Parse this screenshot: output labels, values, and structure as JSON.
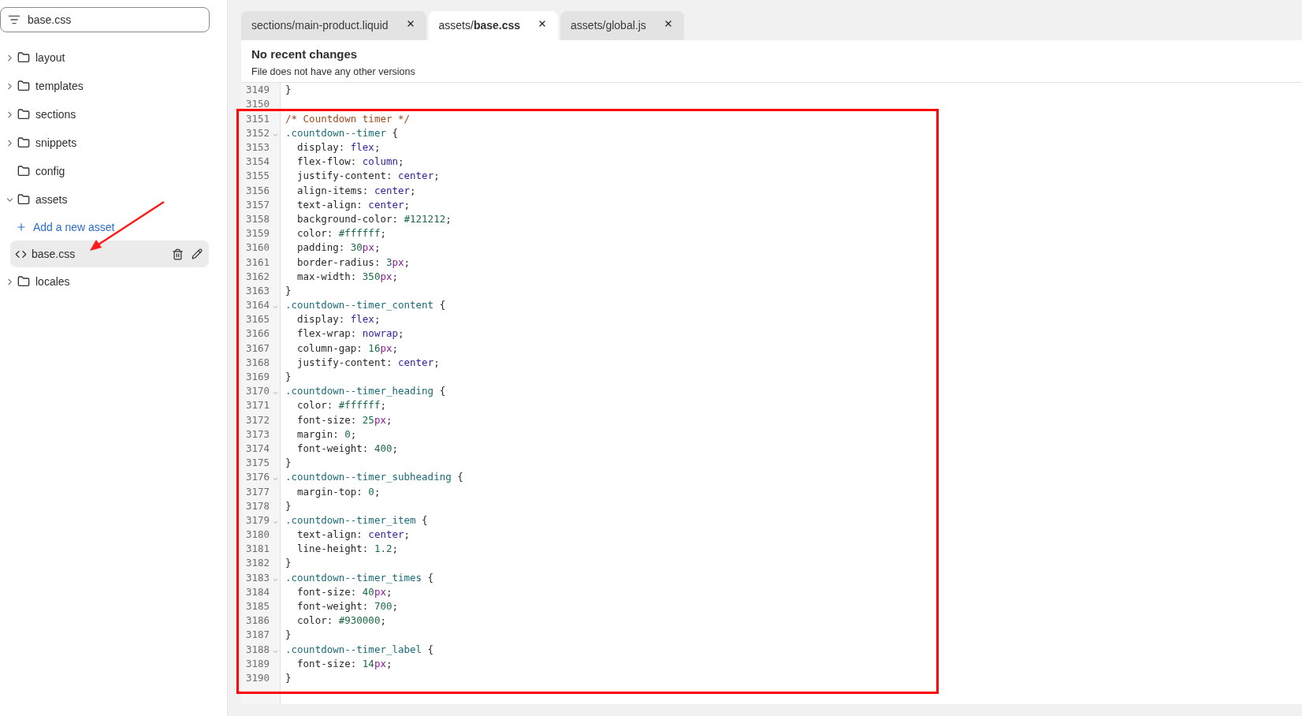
{
  "sidebar": {
    "search": {
      "value": "base.css"
    },
    "tree": [
      {
        "label": "layout",
        "expanded": false
      },
      {
        "label": "templates",
        "expanded": false
      },
      {
        "label": "sections",
        "expanded": false
      },
      {
        "label": "snippets",
        "expanded": false
      },
      {
        "label": "config"
      },
      {
        "label": "assets",
        "expanded": true,
        "children": [
          {
            "kind": "action",
            "label": "Add a new asset"
          },
          {
            "kind": "file",
            "label": "base.css",
            "selected": true
          }
        ]
      },
      {
        "label": "locales",
        "expanded": false
      }
    ]
  },
  "tabs": [
    {
      "label": "sections/main-product.liquid",
      "selected": false
    },
    {
      "label": "assets/**base.css**",
      "selected": true
    },
    {
      "label": "assets/global.js",
      "selected": false
    }
  ],
  "history": {
    "title": "No recent changes",
    "subtitle": "File does not have any other versions"
  },
  "editor": {
    "lines": [
      {
        "number": "3149",
        "tokens": [
          {
            "kind": "plain",
            "text": "}"
          }
        ]
      },
      {
        "number": "3150"
      },
      {
        "number": "3151",
        "tokens": [
          {
            "kind": "comment",
            "text": "/* Countdown timer */"
          }
        ]
      },
      {
        "number": "3152",
        "foldable": true,
        "tokens": [
          {
            "kind": "selector",
            "text": ".countdown--timer"
          },
          {
            "kind": "plain",
            "text": " {"
          }
        ]
      },
      {
        "number": "3153",
        "tokens": [
          {
            "kind": "plain",
            "text": "  display: "
          },
          {
            "kind": "keyword",
            "text": "flex"
          },
          {
            "kind": "plain",
            "text": ";"
          }
        ]
      },
      {
        "number": "3154",
        "tokens": [
          {
            "kind": "plain",
            "text": "  flex-flow: "
          },
          {
            "kind": "keyword",
            "text": "column"
          },
          {
            "kind": "plain",
            "text": ";"
          }
        ]
      },
      {
        "number": "3155",
        "tokens": [
          {
            "kind": "plain",
            "text": "  justify-content: "
          },
          {
            "kind": "keyword",
            "text": "center"
          },
          {
            "kind": "plain",
            "text": ";"
          }
        ]
      },
      {
        "number": "3156",
        "tokens": [
          {
            "kind": "plain",
            "text": "  align-items: "
          },
          {
            "kind": "keyword",
            "text": "center"
          },
          {
            "kind": "plain",
            "text": ";"
          }
        ]
      },
      {
        "number": "3157",
        "tokens": [
          {
            "kind": "plain",
            "text": "  text-align: "
          },
          {
            "kind": "keyword",
            "text": "center"
          },
          {
            "kind": "plain",
            "text": ";"
          }
        ]
      },
      {
        "number": "3158",
        "tokens": [
          {
            "kind": "plain",
            "text": "  background-color: "
          },
          {
            "kind": "number",
            "text": "#121212"
          },
          {
            "kind": "plain",
            "text": ";"
          }
        ]
      },
      {
        "number": "3159",
        "tokens": [
          {
            "kind": "plain",
            "text": "  color: "
          },
          {
            "kind": "number",
            "text": "#ffffff"
          },
          {
            "kind": "plain",
            "text": ";"
          }
        ]
      },
      {
        "number": "3160",
        "tokens": [
          {
            "kind": "plain",
            "text": "  padding: "
          },
          {
            "kind": "number",
            "text": "30"
          },
          {
            "kind": "unit",
            "text": "px"
          },
          {
            "kind": "plain",
            "text": ";"
          }
        ]
      },
      {
        "number": "3161",
        "tokens": [
          {
            "kind": "plain",
            "text": "  border-radius: "
          },
          {
            "kind": "number",
            "text": "3"
          },
          {
            "kind": "unit",
            "text": "px"
          },
          {
            "kind": "plain",
            "text": ";"
          }
        ]
      },
      {
        "number": "3162",
        "tokens": [
          {
            "kind": "plain",
            "text": "  max-width: "
          },
          {
            "kind": "number",
            "text": "350"
          },
          {
            "kind": "unit",
            "text": "px"
          },
          {
            "kind": "plain",
            "text": ";"
          }
        ]
      },
      {
        "number": "3163",
        "tokens": [
          {
            "kind": "plain",
            "text": "}"
          }
        ]
      },
      {
        "number": "3164",
        "foldable": true,
        "tokens": [
          {
            "kind": "selector",
            "text": ".countdown--timer_content"
          },
          {
            "kind": "plain",
            "text": " {"
          }
        ]
      },
      {
        "number": "3165",
        "tokens": [
          {
            "kind": "plain",
            "text": "  display: "
          },
          {
            "kind": "keyword",
            "text": "flex"
          },
          {
            "kind": "plain",
            "text": ";"
          }
        ]
      },
      {
        "number": "3166",
        "tokens": [
          {
            "kind": "plain",
            "text": "  flex-wrap: "
          },
          {
            "kind": "keyword",
            "text": "nowrap"
          },
          {
            "kind": "plain",
            "text": ";"
          }
        ]
      },
      {
        "number": "3167",
        "tokens": [
          {
            "kind": "plain",
            "text": "  column-gap: "
          },
          {
            "kind": "number",
            "text": "16"
          },
          {
            "kind": "unit",
            "text": "px"
          },
          {
            "kind": "plain",
            "text": ";"
          }
        ]
      },
      {
        "number": "3168",
        "tokens": [
          {
            "kind": "plain",
            "text": "  justify-content: "
          },
          {
            "kind": "keyword",
            "text": "center"
          },
          {
            "kind": "plain",
            "text": ";"
          }
        ]
      },
      {
        "number": "3169",
        "tokens": [
          {
            "kind": "plain",
            "text": "}"
          }
        ]
      },
      {
        "number": "3170",
        "foldable": true,
        "tokens": [
          {
            "kind": "selector",
            "text": ".countdown--timer_heading"
          },
          {
            "kind": "plain",
            "text": " {"
          }
        ]
      },
      {
        "number": "3171",
        "tokens": [
          {
            "kind": "plain",
            "text": "  color: "
          },
          {
            "kind": "number",
            "text": "#ffffff"
          },
          {
            "kind": "plain",
            "text": ";"
          }
        ]
      },
      {
        "number": "3172",
        "tokens": [
          {
            "kind": "plain",
            "text": "  font-size: "
          },
          {
            "kind": "number",
            "text": "25"
          },
          {
            "kind": "unit",
            "text": "px"
          },
          {
            "kind": "plain",
            "text": ";"
          }
        ]
      },
      {
        "number": "3173",
        "tokens": [
          {
            "kind": "plain",
            "text": "  margin: "
          },
          {
            "kind": "number",
            "text": "0"
          },
          {
            "kind": "plain",
            "text": ";"
          }
        ]
      },
      {
        "number": "3174",
        "tokens": [
          {
            "kind": "plain",
            "text": "  font-weight: "
          },
          {
            "kind": "number",
            "text": "400"
          },
          {
            "kind": "plain",
            "text": ";"
          }
        ]
      },
      {
        "number": "3175",
        "tokens": [
          {
            "kind": "plain",
            "text": "}"
          }
        ]
      },
      {
        "number": "3176",
        "foldable": true,
        "tokens": [
          {
            "kind": "selector",
            "text": ".countdown--timer_subheading"
          },
          {
            "kind": "plain",
            "text": " {"
          }
        ]
      },
      {
        "number": "3177",
        "tokens": [
          {
            "kind": "plain",
            "text": "  margin-top: "
          },
          {
            "kind": "number",
            "text": "0"
          },
          {
            "kind": "plain",
            "text": ";"
          }
        ]
      },
      {
        "number": "3178",
        "tokens": [
          {
            "kind": "plain",
            "text": "}"
          }
        ]
      },
      {
        "number": "3179",
        "foldable": true,
        "tokens": [
          {
            "kind": "selector",
            "text": ".countdown--timer_item"
          },
          {
            "kind": "plain",
            "text": " {"
          }
        ]
      },
      {
        "number": "3180",
        "tokens": [
          {
            "kind": "plain",
            "text": "  text-align: "
          },
          {
            "kind": "keyword",
            "text": "center"
          },
          {
            "kind": "plain",
            "text": ";"
          }
        ]
      },
      {
        "number": "3181",
        "tokens": [
          {
            "kind": "plain",
            "text": "  line-height: "
          },
          {
            "kind": "number",
            "text": "1.2"
          },
          {
            "kind": "plain",
            "text": ";"
          }
        ]
      },
      {
        "number": "3182",
        "tokens": [
          {
            "kind": "plain",
            "text": "}"
          }
        ]
      },
      {
        "number": "3183",
        "foldable": true,
        "tokens": [
          {
            "kind": "selector",
            "text": ".countdown--timer_times"
          },
          {
            "kind": "plain",
            "text": " {"
          }
        ]
      },
      {
        "number": "3184",
        "tokens": [
          {
            "kind": "plain",
            "text": "  font-size: "
          },
          {
            "kind": "number",
            "text": "40"
          },
          {
            "kind": "unit",
            "text": "px"
          },
          {
            "kind": "plain",
            "text": ";"
          }
        ]
      },
      {
        "number": "3185",
        "tokens": [
          {
            "kind": "plain",
            "text": "  font-weight: "
          },
          {
            "kind": "number",
            "text": "700"
          },
          {
            "kind": "plain",
            "text": ";"
          }
        ]
      },
      {
        "number": "3186",
        "tokens": [
          {
            "kind": "plain",
            "text": "  color: "
          },
          {
            "kind": "number",
            "text": "#930000"
          },
          {
            "kind": "plain",
            "text": ";"
          }
        ]
      },
      {
        "number": "3187",
        "tokens": [
          {
            "kind": "plain",
            "text": "}"
          }
        ]
      },
      {
        "number": "3188",
        "foldable": true,
        "tokens": [
          {
            "kind": "selector",
            "text": ".countdown--timer_label"
          },
          {
            "kind": "plain",
            "text": " {"
          }
        ]
      },
      {
        "number": "3189",
        "tokens": [
          {
            "kind": "plain",
            "text": "  font-size: "
          },
          {
            "kind": "number",
            "text": "14"
          },
          {
            "kind": "unit",
            "text": "px"
          },
          {
            "kind": "plain",
            "text": ";"
          }
        ]
      },
      {
        "number": "3190",
        "tokens": [
          {
            "kind": "plain",
            "text": "}"
          }
        ]
      }
    ]
  }
}
